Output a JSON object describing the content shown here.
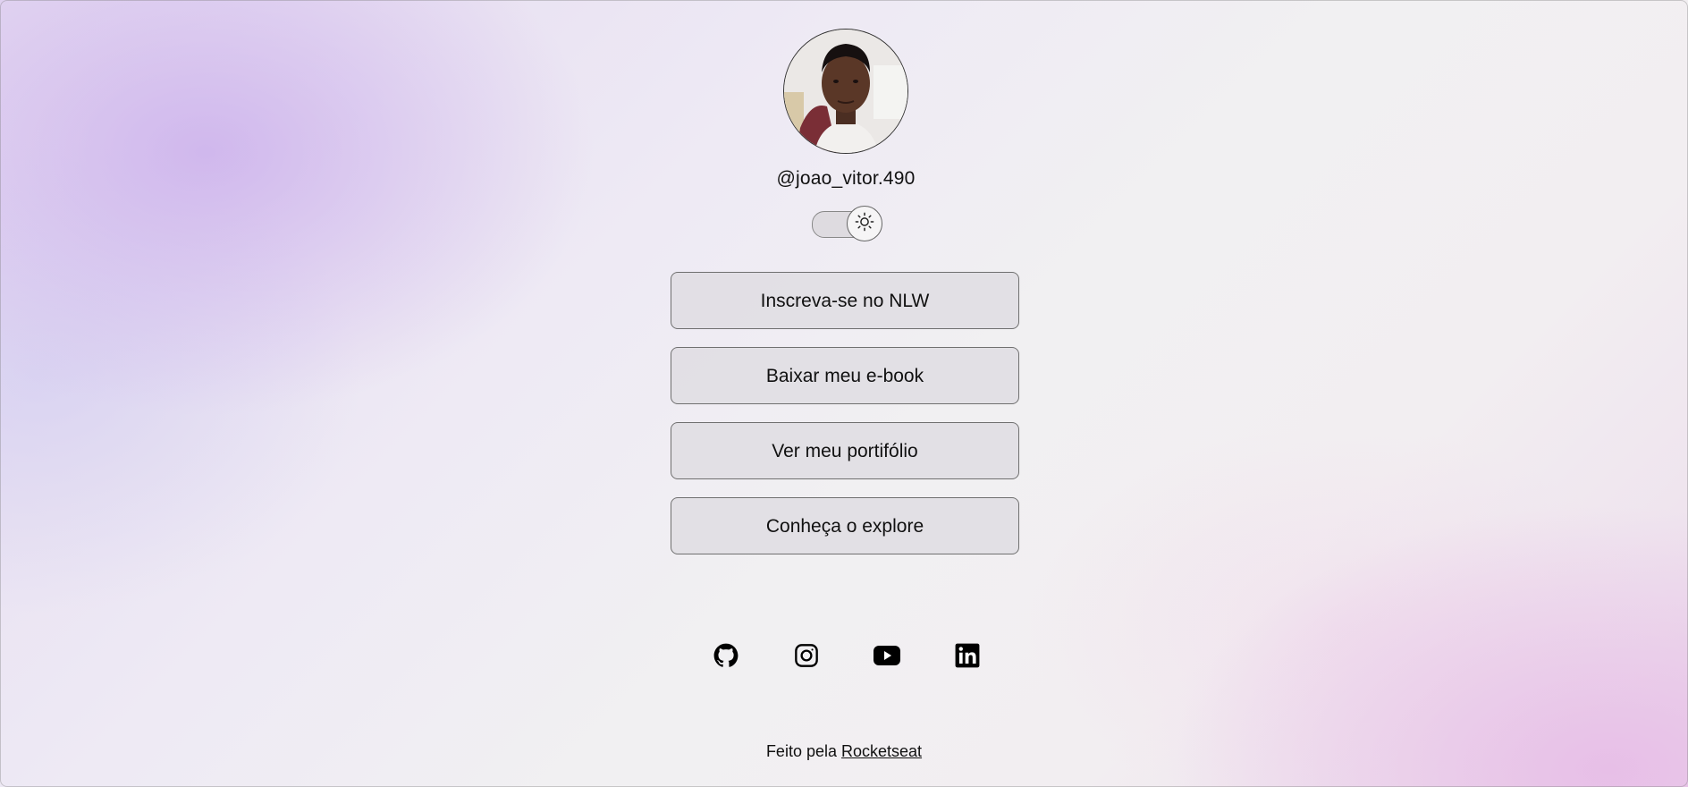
{
  "profile": {
    "username": "@joao_vitor.490"
  },
  "theme_switch": {
    "icon": "sun-icon"
  },
  "links": [
    {
      "label": "Inscreva-se no NLW"
    },
    {
      "label": "Baixar meu e-book"
    },
    {
      "label": "Ver meu portifólio"
    },
    {
      "label": "Conheça o explore"
    }
  ],
  "social": [
    {
      "icon": "github-icon"
    },
    {
      "icon": "instagram-icon"
    },
    {
      "icon": "youtube-icon"
    },
    {
      "icon": "linkedin-icon"
    }
  ],
  "footer": {
    "prefix": "Feito pela",
    "link_label": "Rocketseat"
  },
  "colors": {
    "text": "#111111",
    "button_bg": "#e0dee3",
    "button_border": "#707070",
    "gradient_purple": "#c8aaeb",
    "gradient_pink": "#e6b9e6"
  }
}
